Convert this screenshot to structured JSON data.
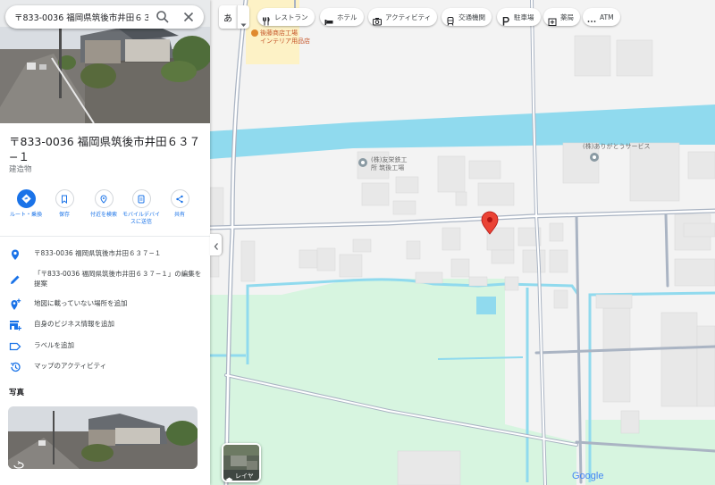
{
  "search": {
    "value": "〒833-0036 福岡県筑後市井田６３７"
  },
  "place": {
    "title": "〒833-0036 福岡県筑後市井田６３７−１",
    "category": "建造物"
  },
  "actions": [
    {
      "label": "ルート・乗換"
    },
    {
      "label": "保存"
    },
    {
      "label": "付近を検索"
    },
    {
      "label": "モバイルデバイスに送信"
    },
    {
      "label": "共有"
    }
  ],
  "info": {
    "address": "〒833-0036 福岡県筑後市井田６３７−１",
    "suggest_edit": "「〒833-0036 福岡県筑後市井田６３７−１」の編集を提案",
    "add_missing_place": "地図に載っていない場所を追加",
    "add_business": "自身のビジネス情報を追加",
    "add_label": "ラベルを追加",
    "map_activity": "マップのアクティビティ"
  },
  "photos": {
    "title": "写真"
  },
  "map": {
    "language_button": "あ",
    "chips": [
      {
        "label": "レストラン",
        "icon": "fork-knife-icon"
      },
      {
        "label": "ホテル",
        "icon": "bed-icon"
      },
      {
        "label": "アクティビティ",
        "icon": "camera-icon"
      },
      {
        "label": "交通機関",
        "icon": "train-icon"
      },
      {
        "label": "駐車場",
        "icon": "parking-icon"
      },
      {
        "label": "薬局",
        "icon": "pharmacy-icon"
      },
      {
        "label": "ATM",
        "icon": "more-dots-icon"
      }
    ],
    "labels": {
      "factory1_line1": "後藤商店工場",
      "factory1_line2": "インテリア用品店",
      "company1_line1": "(株)友栄鉄工",
      "company1_line2": "所 筑後工場",
      "company2": "(株)ありがとうサービス"
    },
    "layer_button": "レイヤ",
    "logo": "Google"
  },
  "colors": {
    "accent": "#1a73e8",
    "water": "#90daee",
    "park": "#d7f5e0",
    "road": "#aab4c3",
    "pin": "#ea4335"
  }
}
